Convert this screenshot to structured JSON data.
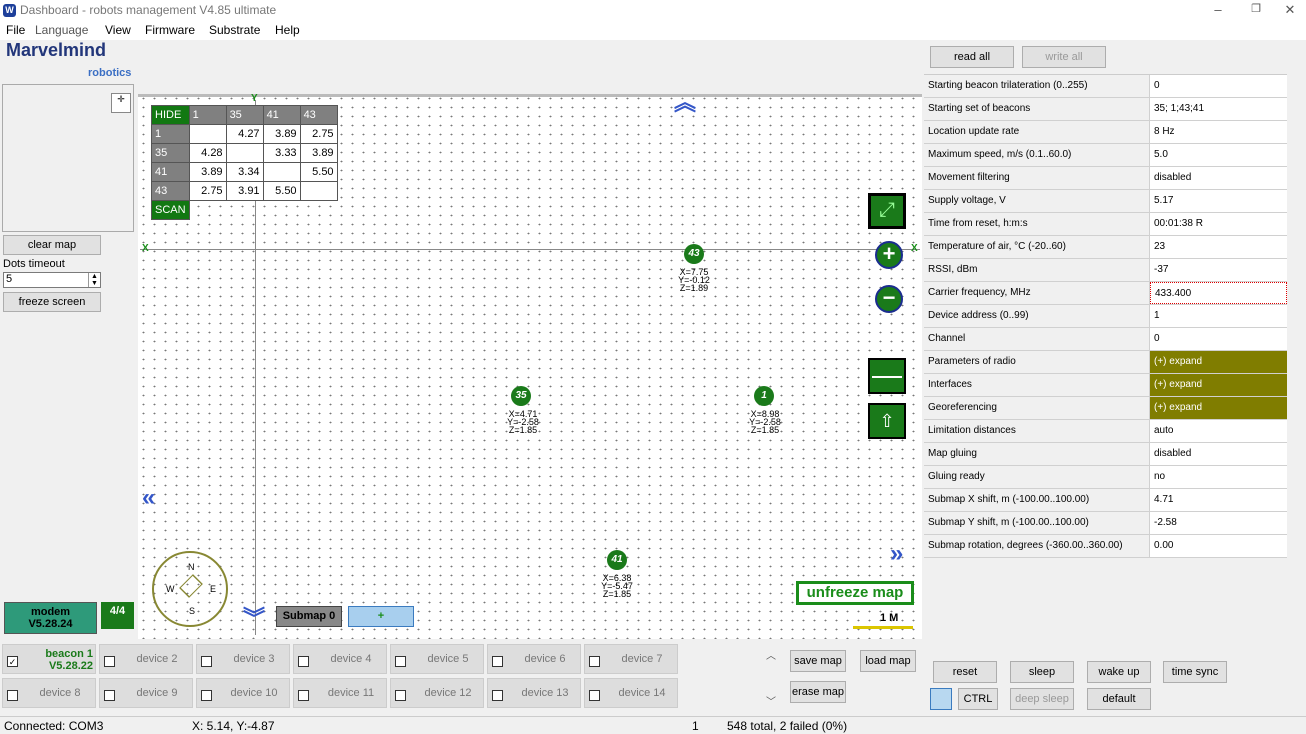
{
  "window": {
    "title": "Dashboard - robots management  V4.85  ultimate",
    "minimize": "–",
    "maximize": "❐",
    "close": "✕",
    "app_icon": "marvelmind-icon"
  },
  "menu": [
    "File",
    "Language",
    "View",
    "Firmware",
    "Substrate",
    "Help"
  ],
  "brand": {
    "name": "Marvelmind",
    "sub": "robotics"
  },
  "left": {
    "clear_map": "clear map",
    "dots_timeout_label": "Dots timeout",
    "dots_timeout_value": "5",
    "freeze_screen": "freeze screen",
    "modem_label": "modem",
    "modem_version": "V5.28.24",
    "count": "4/4"
  },
  "table": {
    "hide": "HIDE",
    "scan": "SCAN",
    "cols": [
      "1",
      "35",
      "41",
      "43"
    ],
    "rows": [
      {
        "id": "1",
        "vals": [
          "",
          "4.27",
          "3.89",
          "2.75"
        ]
      },
      {
        "id": "35",
        "vals": [
          "4.28",
          "",
          "3.33",
          "3.89"
        ]
      },
      {
        "id": "41",
        "vals": [
          "3.89",
          "3.34",
          "",
          "5.50"
        ]
      },
      {
        "id": "43",
        "vals": [
          "2.75",
          "3.91",
          "5.50",
          ""
        ]
      }
    ]
  },
  "map": {
    "axis_x": "X",
    "axis_y": "Y",
    "submap": "Submap 0",
    "submap_add": "+",
    "unfreeze": "unfreeze map",
    "scale": "1 M",
    "compass": {
      "n": "N",
      "s": "S",
      "w": "W",
      "e": "E"
    },
    "beacons": [
      {
        "id": "43",
        "x": "X=7.75",
        "y": "Y=-0.12",
        "z": "Z=1.89"
      },
      {
        "id": "35",
        "x": "X=4.71",
        "y": "Y=-2.58",
        "z": "Z=1.85"
      },
      {
        "id": "1",
        "x": "X=8.98",
        "y": "Y=-2.58",
        "z": "Z=1.85"
      },
      {
        "id": "41",
        "x": "X=6.38",
        "y": "Y=-5.47",
        "z": "Z=1.85"
      }
    ]
  },
  "props_header": {
    "read_all": "read all",
    "write_all": "write all"
  },
  "props": [
    {
      "k": "Starting beacon trilateration (0..255)",
      "v": "0"
    },
    {
      "k": "Starting set of beacons",
      "v": "35;  1;43;41"
    },
    {
      "k": "Location update rate",
      "v": "8 Hz"
    },
    {
      "k": "Maximum speed, m/s (0.1..60.0)",
      "v": "5.0"
    },
    {
      "k": "Movement filtering",
      "v": "disabled"
    },
    {
      "k": "Supply voltage, V",
      "v": "5.17"
    },
    {
      "k": "Time from reset, h:m:s",
      "v": "00:01:38  R"
    },
    {
      "k": "Temperature of air, °C (-20..60)",
      "v": "23"
    },
    {
      "k": "RSSI, dBm",
      "v": "-37"
    },
    {
      "k": "Carrier frequency, MHz",
      "v": "433.400"
    },
    {
      "k": "Device address (0..99)",
      "v": "1"
    },
    {
      "k": "Channel",
      "v": "0"
    },
    {
      "k": "Parameters of radio",
      "v": "(+) expand"
    },
    {
      "k": "Interfaces",
      "v": "(+) expand"
    },
    {
      "k": "Georeferencing",
      "v": "(+) expand"
    },
    {
      "k": "Limitation distances",
      "v": "auto"
    },
    {
      "k": "Map gluing",
      "v": "disabled"
    },
    {
      "k": "Gluing ready",
      "v": "no"
    },
    {
      "k": "Submap X shift, m (-100.00..100.00)",
      "v": "4.71"
    },
    {
      "k": "Submap Y shift, m (-100.00..100.00)",
      "v": "-2.58"
    },
    {
      "k": "Submap rotation, degrees (-360.00..360.00)",
      "v": "0.00"
    }
  ],
  "devices_row1": [
    {
      "name": "beacon 1",
      "ver": "V5.28.22"
    },
    "device 2",
    "device 3",
    "device 4",
    "device 5",
    "device 6",
    "device 7"
  ],
  "devices_row2": [
    "device 8",
    "device 9",
    "device 10",
    "device 11",
    "device 12",
    "device 13",
    "device 14"
  ],
  "map_buttons": {
    "save": "save map",
    "load": "load map",
    "erase": "erase map"
  },
  "right_buttons": {
    "reset": "reset",
    "sleep": "sleep",
    "wake_up": "wake up",
    "time_sync": "time sync",
    "ctrl": "CTRL",
    "deep_sleep": "deep sleep",
    "default": "default"
  },
  "status": {
    "connected": "Connected: COM3",
    "coords": "X: 5.14, Y:-4.87",
    "num": "1",
    "stats": "548 total, 2 failed (0%)"
  },
  "colors": {
    "green": "#1a7a1a",
    "olive": "#807d00",
    "blue_arrow": "#3456c8"
  }
}
